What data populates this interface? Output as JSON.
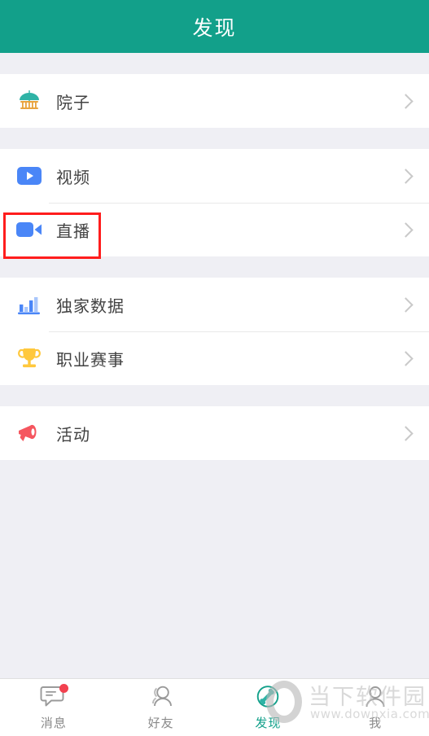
{
  "header": {
    "title": "发现",
    "bg_color": "#12a08a",
    "text_color": "#ffffff"
  },
  "groups": [
    {
      "rows": [
        {
          "label": "院子",
          "icon": "parasol-icon",
          "arrow": "chevron-right-icon",
          "highlighted": false
        }
      ]
    },
    {
      "rows": [
        {
          "label": "视频",
          "icon": "video-play-icon",
          "arrow": "chevron-right-icon",
          "highlighted": false
        },
        {
          "label": "直播",
          "icon": "live-camera-icon",
          "arrow": "chevron-right-icon",
          "highlighted": true
        }
      ]
    },
    {
      "rows": [
        {
          "label": "独家数据",
          "icon": "bar-chart-icon",
          "arrow": "chevron-right-icon",
          "highlighted": false
        },
        {
          "label": "职业赛事",
          "icon": "trophy-icon",
          "arrow": "chevron-right-icon",
          "highlighted": false
        }
      ]
    },
    {
      "rows": [
        {
          "label": "活动",
          "icon": "megaphone-icon",
          "arrow": "chevron-right-icon",
          "highlighted": false
        }
      ]
    }
  ],
  "highlight": {
    "color": "#ff1d1d",
    "target_label": "直播"
  },
  "tabbar": {
    "items": [
      {
        "label": "消息",
        "icon": "chat-bubble-icon",
        "active": false,
        "badge": true
      },
      {
        "label": "好友",
        "icon": "friends-icon",
        "active": false,
        "badge": false
      },
      {
        "label": "发现",
        "icon": "bone-compass-icon",
        "active": true,
        "badge": false
      },
      {
        "label": "我",
        "icon": "profile-icon",
        "active": false,
        "badge": false
      }
    ],
    "active_color": "#12a08a",
    "inactive_color": "#8a8a8a",
    "badge_color": "#f2414f"
  },
  "watermark": {
    "site_name": "当下软件园",
    "url": "www.downxia.com",
    "logo": "o-ring-logo"
  }
}
